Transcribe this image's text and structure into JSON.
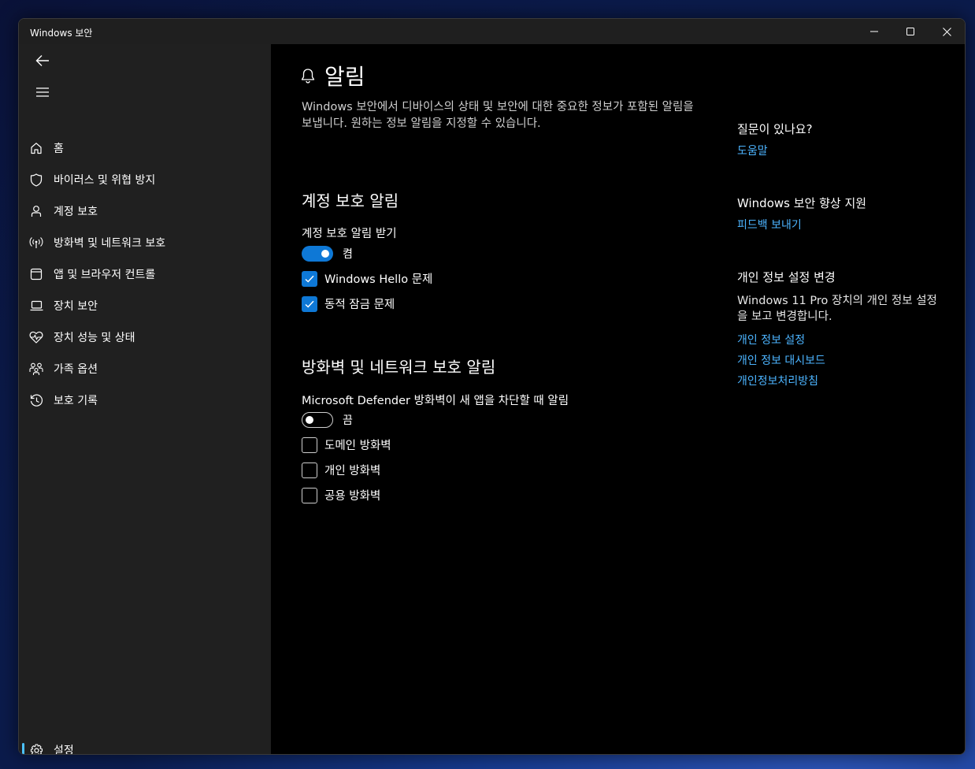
{
  "window": {
    "title": "Windows 보안"
  },
  "sidebar": {
    "items": [
      {
        "label": "홈",
        "icon": "home-icon"
      },
      {
        "label": "바이러스 및 위협 방지",
        "icon": "shield-icon"
      },
      {
        "label": "계정 보호",
        "icon": "person-icon"
      },
      {
        "label": "방화벽 및 네트워크 보호",
        "icon": "wireless-icon"
      },
      {
        "label": "앱 및 브라우저 컨트롤",
        "icon": "app-window-icon"
      },
      {
        "label": "장치 보안",
        "icon": "laptop-icon"
      },
      {
        "label": "장치 성능 및 상태",
        "icon": "heart-pulse-icon"
      },
      {
        "label": "가족 옵션",
        "icon": "family-icon"
      },
      {
        "label": "보호 기록",
        "icon": "history-icon"
      }
    ],
    "settings_label": "설정"
  },
  "main": {
    "title": "알림",
    "description": "Windows 보안에서 디바이스의 상태 및 보안에 대한 중요한 정보가 포함된 알림을 보냅니다. 원하는 정보 알림을 지정할 수 있습니다.",
    "account_section": {
      "title": "계정 보호 알림",
      "toggle_label": "계정 보호 알림 받기",
      "toggle_state": "켬",
      "checks": [
        {
          "label": "Windows Hello 문제",
          "checked": true
        },
        {
          "label": "동적 잠금 문제",
          "checked": true
        }
      ]
    },
    "firewall_section": {
      "title": "방화벽 및 네트워크 보호 알림",
      "toggle_label": "Microsoft Defender 방화벽이 새 앱을 차단할 때 알림",
      "toggle_state": "끔",
      "checks": [
        {
          "label": "도메인 방화벽",
          "checked": false
        },
        {
          "label": "개인 방화벽",
          "checked": false
        },
        {
          "label": "공용 방화벽",
          "checked": false
        }
      ]
    }
  },
  "right": {
    "question_title": "질문이 있나요?",
    "help_link": "도움말",
    "improve_title": "Windows 보안 향상 지원",
    "feedback_link": "피드백 보내기",
    "privacy_title": "개인 정보 설정 변경",
    "privacy_text": "Windows 11 Pro 장치의 개인 정보 설정을 보고 변경합니다.",
    "privacy_links": [
      "개인 정보 설정",
      "개인 정보 대시보드",
      "개인정보처리방침"
    ]
  },
  "colors": {
    "accent": "#0e78d6",
    "link": "#4cb4ff",
    "sidebar_bg": "#202020",
    "active_indicator": "#4cc2ff"
  }
}
